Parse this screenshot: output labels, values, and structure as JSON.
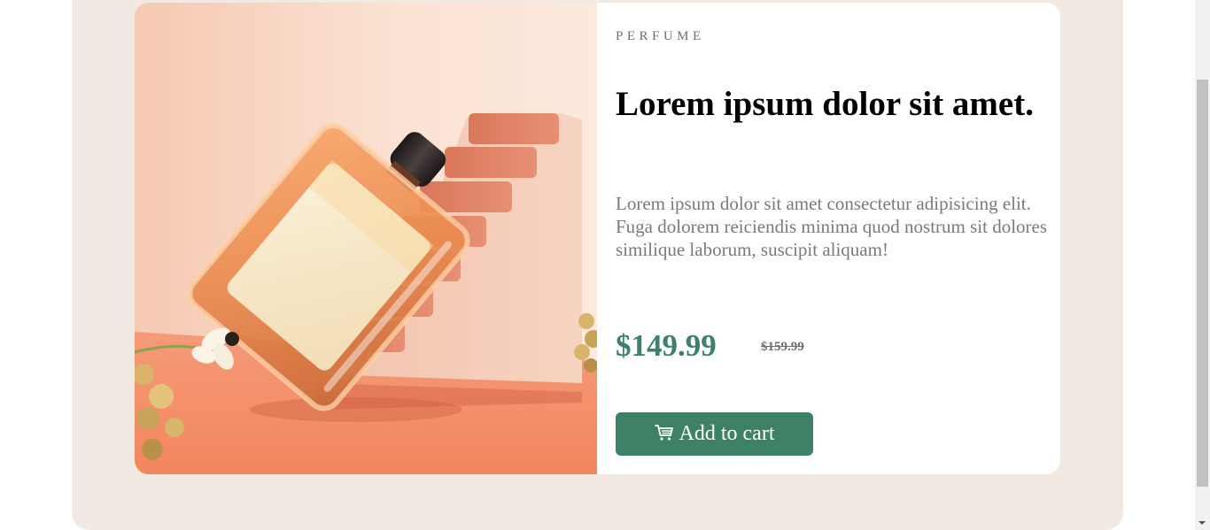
{
  "product": {
    "category": "PERFUME",
    "title": "Lorem ipsum dolor sit amet.",
    "description": "Lorem ipsum dolor sit amet consectetur adipisicing elit. Fuga dolorem reiciendis minima quod nostrum sit dolores similique laborum, suscipit aliquam!",
    "price": "$149.99",
    "old_price": "$159.99",
    "add_to_cart_label": "Add to cart",
    "cart_icon": "cart-icon",
    "image_icon": "perfume-bottle-image"
  },
  "colors": {
    "accent": "#3d8166",
    "page_background": "#f3e9e3",
    "card_background": "#ffffff",
    "muted_text": "#7a7a7a"
  }
}
